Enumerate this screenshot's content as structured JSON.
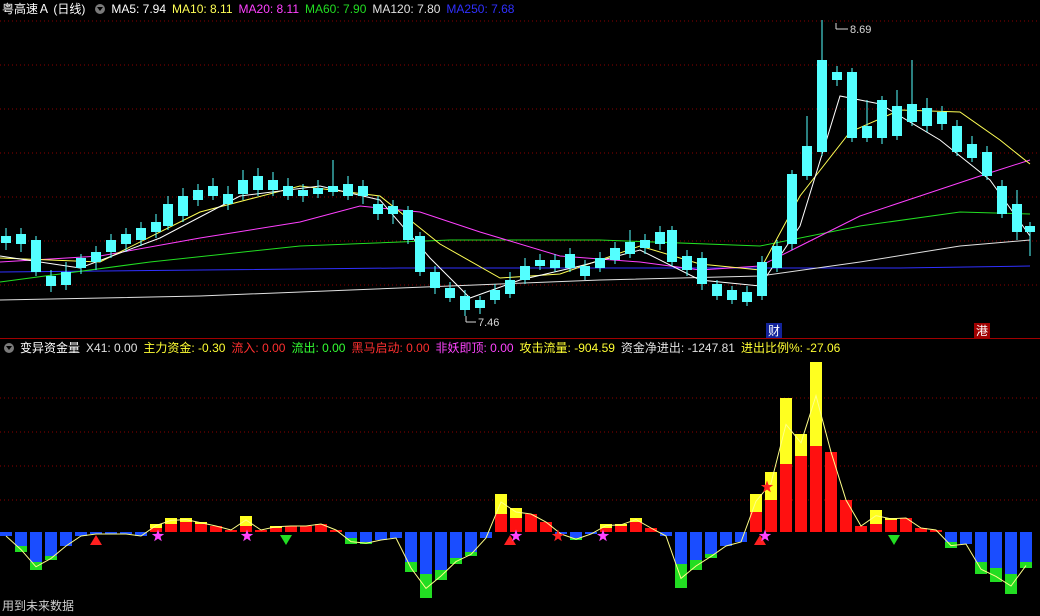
{
  "stock_title": "粤高速Ａ (日线)",
  "ma": [
    {
      "label": "MA5:",
      "value": "7.94",
      "color": "#ffffff"
    },
    {
      "label": "MA10:",
      "value": "8.11",
      "color": "#ffff55"
    },
    {
      "label": "MA20:",
      "value": "8.11",
      "color": "#ff40ff"
    },
    {
      "label": "MA60:",
      "value": "7.90",
      "color": "#22dd22"
    },
    {
      "label": "MA120:",
      "value": "7.80",
      "color": "#e0e0e0"
    },
    {
      "label": "MA250:",
      "value": "7.68",
      "color": "#3030ff"
    }
  ],
  "indicator_title": "变异资金量",
  "indicator_values": [
    {
      "label": "X41:",
      "value": "0.00",
      "color": "#e0e0e0"
    },
    {
      "label": "主力资金:",
      "value": "-0.30",
      "color": "#ffff33"
    },
    {
      "label": "流入:",
      "value": "0.00",
      "color": "#ff3030"
    },
    {
      "label": "流出:",
      "value": "0.00",
      "color": "#33ff33"
    },
    {
      "label": "黑马启动:",
      "value": "0.00",
      "color": "#ff3030"
    },
    {
      "label": "非妖即顶:",
      "value": "0.00",
      "color": "#ff44ff"
    },
    {
      "label": "攻击流量:",
      "value": "-904.59",
      "color": "#ffff33"
    },
    {
      "label": "资金净进出:",
      "value": "-1247.81",
      "color": "#e0e0e0"
    },
    {
      "label": "进出比例%:",
      "value": "-27.06",
      "color": "#ffff33"
    }
  ],
  "price_high_label": "8.69",
  "price_low_label": "7.46",
  "markers": {
    "cai": "财",
    "gang": "港"
  },
  "footer": "用到未来数据",
  "colors": {
    "up": "#ff3c3c",
    "down": "#54ffff",
    "flow_in": "#ff1010",
    "flow_out": "#1a4dff",
    "attack": "#ffff20",
    "green": "#22dd22",
    "grid": "#8b0000"
  }
}
